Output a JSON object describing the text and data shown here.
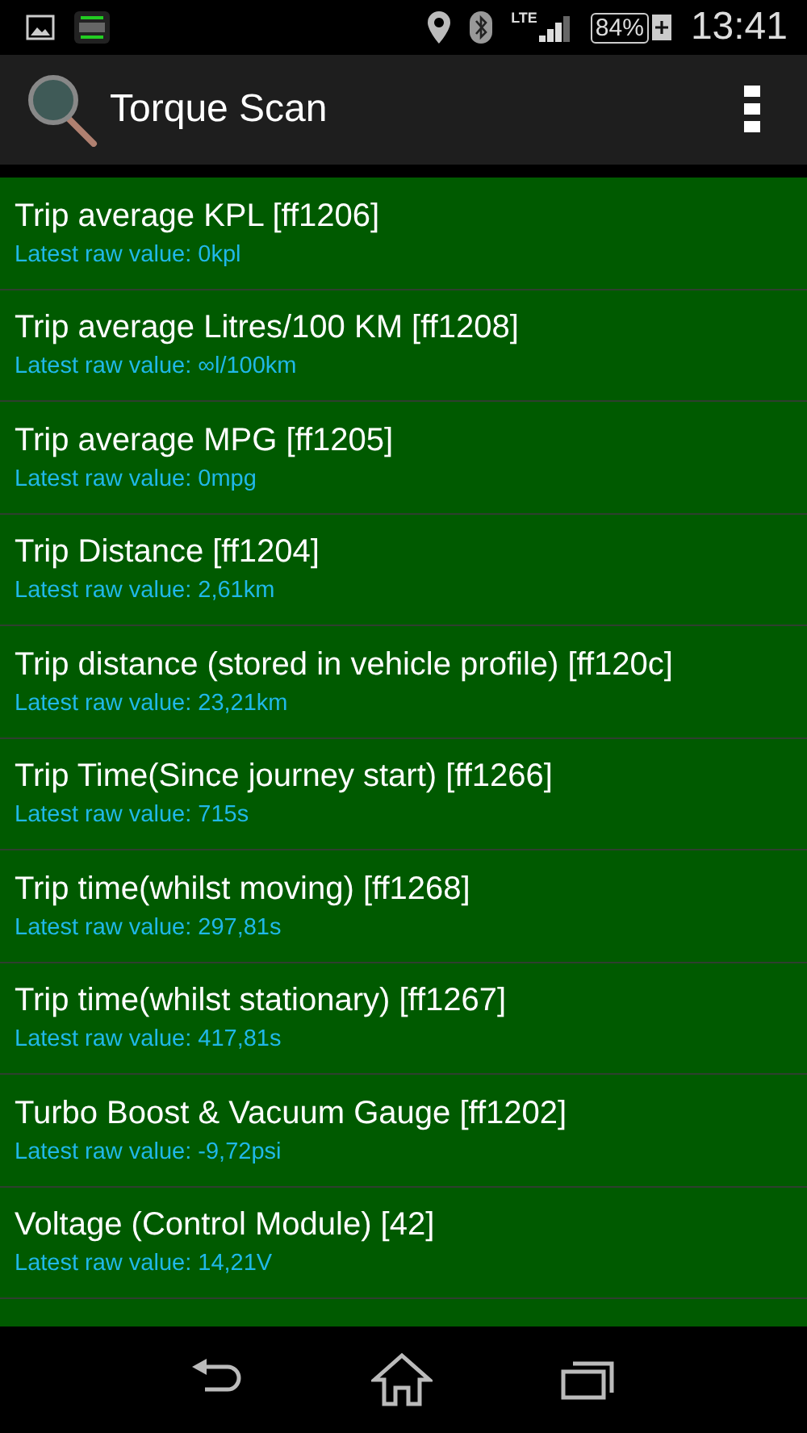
{
  "status_bar": {
    "network": "LTE",
    "battery": "84%",
    "time": "13:41"
  },
  "app_bar": {
    "title": "Torque Scan"
  },
  "items": [
    {
      "title": "Trip average KPL [ff1206]",
      "value": "Latest raw value: 0kpl"
    },
    {
      "title": "Trip average Litres/100 KM [ff1208]",
      "value": "Latest raw value: ∞l/100km"
    },
    {
      "title": "Trip average MPG [ff1205]",
      "value": "Latest raw value: 0mpg"
    },
    {
      "title": "Trip Distance [ff1204]",
      "value": "Latest raw value: 2,61km"
    },
    {
      "title": "Trip distance (stored in vehicle profile) [ff120c]",
      "value": "Latest raw value: 23,21km"
    },
    {
      "title": "Trip Time(Since journey start) [ff1266]",
      "value": "Latest raw value: 715s"
    },
    {
      "title": "Trip time(whilst moving) [ff1268]",
      "value": "Latest raw value: 297,81s"
    },
    {
      "title": "Trip time(whilst stationary) [ff1267]",
      "value": "Latest raw value: 417,81s"
    },
    {
      "title": "Turbo Boost & Vacuum Gauge [ff1202]",
      "value": "Latest raw value: -9,72psi"
    },
    {
      "title": "Voltage (Control Module) [42]",
      "value": "Latest raw value: 14,21V"
    }
  ]
}
